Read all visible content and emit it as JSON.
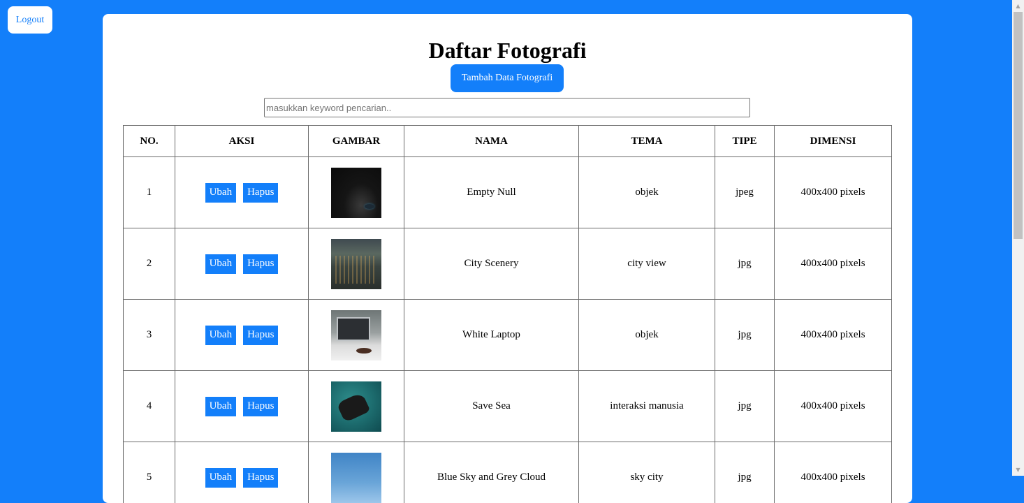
{
  "logout_label": "Logout",
  "page_title": "Daftar Fotografi",
  "add_button_label": "Tambah Data Fotografi",
  "search": {
    "placeholder": "masukkan keyword pencarian..",
    "value": ""
  },
  "table": {
    "headers": [
      "NO.",
      "AKSI",
      "GAMBAR",
      "NAMA",
      "TEMA",
      "TIPE",
      "DIMENSI"
    ],
    "edit_label": "Ubah",
    "delete_label": "Hapus",
    "rows": [
      {
        "no": "1",
        "nama": "Empty Null",
        "tema": "objek",
        "tipe": "jpeg",
        "dimensi": "400x400 pixels"
      },
      {
        "no": "2",
        "nama": "City Scenery",
        "tema": "city view",
        "tipe": "jpg",
        "dimensi": "400x400 pixels"
      },
      {
        "no": "3",
        "nama": "White Laptop",
        "tema": "objek",
        "tipe": "jpg",
        "dimensi": "400x400 pixels"
      },
      {
        "no": "4",
        "nama": "Save Sea",
        "tema": "interaksi manusia",
        "tipe": "jpg",
        "dimensi": "400x400 pixels"
      },
      {
        "no": "5",
        "nama": "Blue Sky and Grey Cloud",
        "tema": "sky city",
        "tipe": "jpg",
        "dimensi": "400x400 pixels"
      }
    ]
  },
  "colors": {
    "accent": "#137ffa",
    "card": "#ffffff"
  }
}
